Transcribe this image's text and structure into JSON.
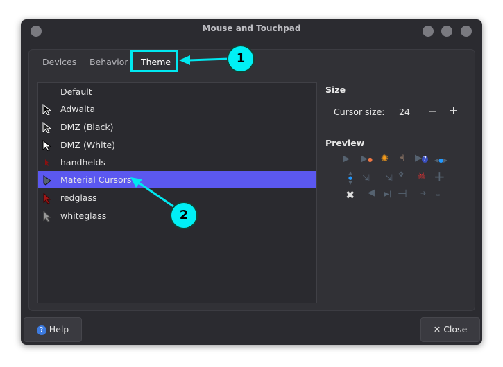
{
  "window": {
    "title": "Mouse and Touchpad"
  },
  "tabs": [
    {
      "label": "Devices"
    },
    {
      "label": "Behavior"
    },
    {
      "label": "Theme"
    }
  ],
  "themes": [
    {
      "label": "Default"
    },
    {
      "label": "Adwaita"
    },
    {
      "label": "DMZ (Black)"
    },
    {
      "label": "DMZ (White)"
    },
    {
      "label": "handhelds"
    },
    {
      "label": "Material Cursors"
    },
    {
      "label": "redglass"
    },
    {
      "label": "whiteglass"
    }
  ],
  "selected_theme": "Material Cursors",
  "size": {
    "heading": "Size",
    "label": "Cursor size:",
    "value": "24",
    "minus": "−",
    "plus": "+"
  },
  "preview": {
    "heading": "Preview"
  },
  "buttons": {
    "help": "Help",
    "close": "Close"
  },
  "annotations": {
    "one": "1",
    "two": "2"
  },
  "colors": {
    "accent": "#5b58f0",
    "annotation": "#00f0f5"
  }
}
